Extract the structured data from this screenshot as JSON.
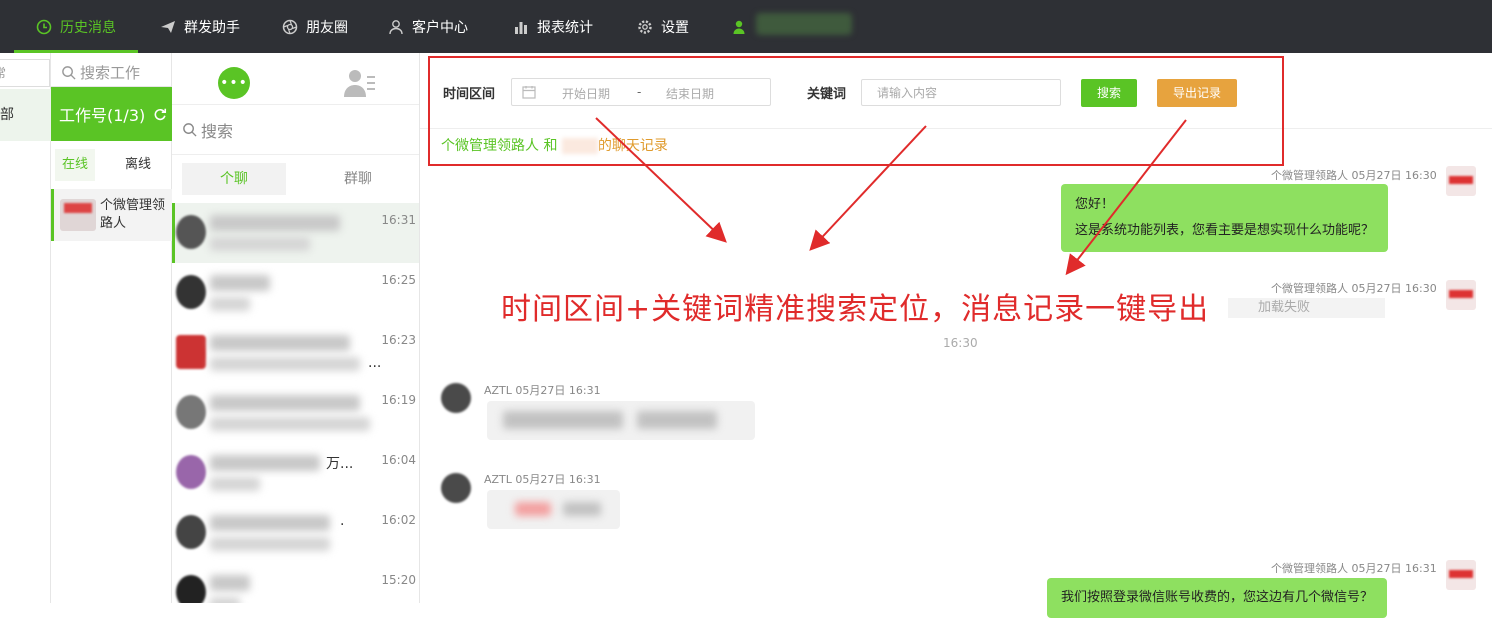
{
  "nav": {
    "items": [
      {
        "label": "历史消息",
        "icon": "clock-icon",
        "active": true
      },
      {
        "label": "群发助手",
        "icon": "paper-plane-icon",
        "active": false
      },
      {
        "label": "朋友圈",
        "icon": "aperture-icon",
        "active": false
      },
      {
        "label": "客户中心",
        "icon": "user-icon",
        "active": false
      },
      {
        "label": "报表统计",
        "icon": "bar-chart-icon",
        "active": false
      },
      {
        "label": "设置",
        "icon": "gear-icon",
        "active": false
      }
    ],
    "user_icon": "user-icon",
    "accent": "#5ac425",
    "background": "#2e3035"
  },
  "col1": {
    "search_fragment": "常",
    "dept_fragment": "部"
  },
  "col2": {
    "search_placeholder": "搜索工作",
    "header_label": "工作号(1/3)",
    "refresh_icon": "refresh-icon",
    "tab_online": "在线",
    "tab_offline": "离线",
    "account_name": "个微管理领路人"
  },
  "col3": {
    "search_placeholder": "搜索",
    "tab_private": "个聊",
    "tab_group": "群聊",
    "contacts": [
      {
        "snippet": "",
        "time": "16:31",
        "selected": true
      },
      {
        "snippet": "",
        "time": "16:25",
        "selected": false
      },
      {
        "snippet": "...",
        "time": "16:23",
        "selected": false
      },
      {
        "snippet": "",
        "time": "16:19",
        "selected": false
      },
      {
        "snippet": "万...",
        "time": "16:04",
        "selected": false
      },
      {
        "snippet": ".",
        "time": "16:02",
        "selected": false
      },
      {
        "snippet": "",
        "time": "15:20",
        "selected": false
      }
    ]
  },
  "filter": {
    "time_label": "时间区间",
    "start_placeholder": "开始日期",
    "separator": "-",
    "end_placeholder": "结束日期",
    "keyword_label": "关键词",
    "keyword_placeholder": "请输入内容",
    "search_button": "搜索",
    "export_button": "导出记录",
    "chat_title_prefix": "个微管理领路人 和",
    "chat_title_suffix": "的聊天记录"
  },
  "annotation": {
    "text": "时间区间+关键词精准搜索定位，消息记录一键导出",
    "color": "#e02b2b"
  },
  "messages": {
    "m1_meta": "个微管理领路人 05月27日 16:30",
    "m1_line1": "您好！",
    "m1_line2": "这是系统功能列表，您看主要是想实现什么功能呢？",
    "m2_meta": "个微管理领路人 05月27日 16:30",
    "m2_fail": "加载失败",
    "center_time": "16:30",
    "m3_meta": "AZTL 05月27日 16:31",
    "m4_meta": "AZTL 05月27日 16:31",
    "m5_meta": "个微管理领路人 05月27日 16:31",
    "m5_text": "我们按照登录微信账号收费的，您这边有几个微信号？"
  }
}
